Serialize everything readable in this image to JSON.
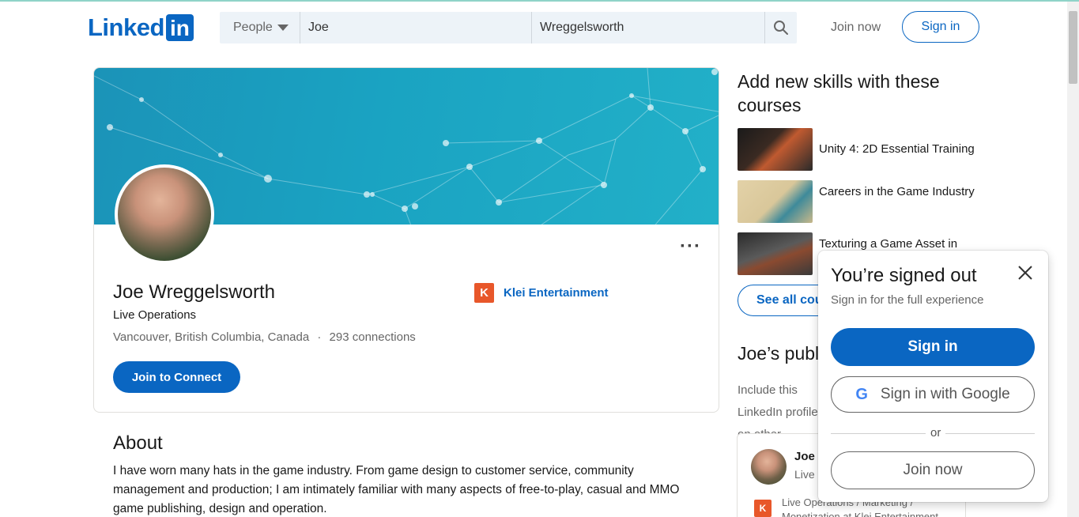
{
  "header": {
    "logo_text": "Linked",
    "logo_box": "in",
    "search": {
      "category": "People",
      "first_name": "Joe",
      "last_name": "Wreggelsworth"
    },
    "join_label": "Join now",
    "signin_label": "Sign in"
  },
  "profile": {
    "name": "Joe Wreggelsworth",
    "headline": "Live Operations",
    "location": "Vancouver, British Columbia, Canada",
    "separator": "·",
    "connections": "293 connections",
    "company": "Klei Entertainment",
    "company_logo": "K",
    "connect_label": "Join to Connect",
    "more_label": "···"
  },
  "about": {
    "title": "About",
    "text": "I have worn many hats in the game industry. From game design to customer service, community management and production; I am intimately familiar with many aspects of free-to-play, casual and MMO game publishing, design and operation."
  },
  "courses": {
    "title": "Add new skills with these courses",
    "items": [
      {
        "title": "Unity 4: 2D Essential Training",
        "thumb_color": "#3a2a22"
      },
      {
        "title": "Careers in the Game Industry",
        "thumb_color": "#d9c79a"
      },
      {
        "title": "Texturing a Game Asset in",
        "thumb_color": "#4a4a4a"
      }
    ],
    "see_all_label": "See all courses"
  },
  "publications": {
    "title": "Joe’s public profile badge",
    "desc": "Include this LinkedIn profile on other websites",
    "card": {
      "name": "Joe Wreggelsworth",
      "sub": "Live Operations",
      "role": "Live Operations / Marketing / Monetization at Klei Entertainment",
      "logo": "K"
    }
  },
  "modal": {
    "title": "You’re signed out",
    "subtitle": "Sign in for the full experience",
    "signin_label": "Sign in",
    "google_label": "Sign in with Google",
    "google_glyph": "G",
    "or_label": "or",
    "join_label": "Join now"
  },
  "colors": {
    "brand": "#0a66c2",
    "klei": "#e8572a"
  }
}
